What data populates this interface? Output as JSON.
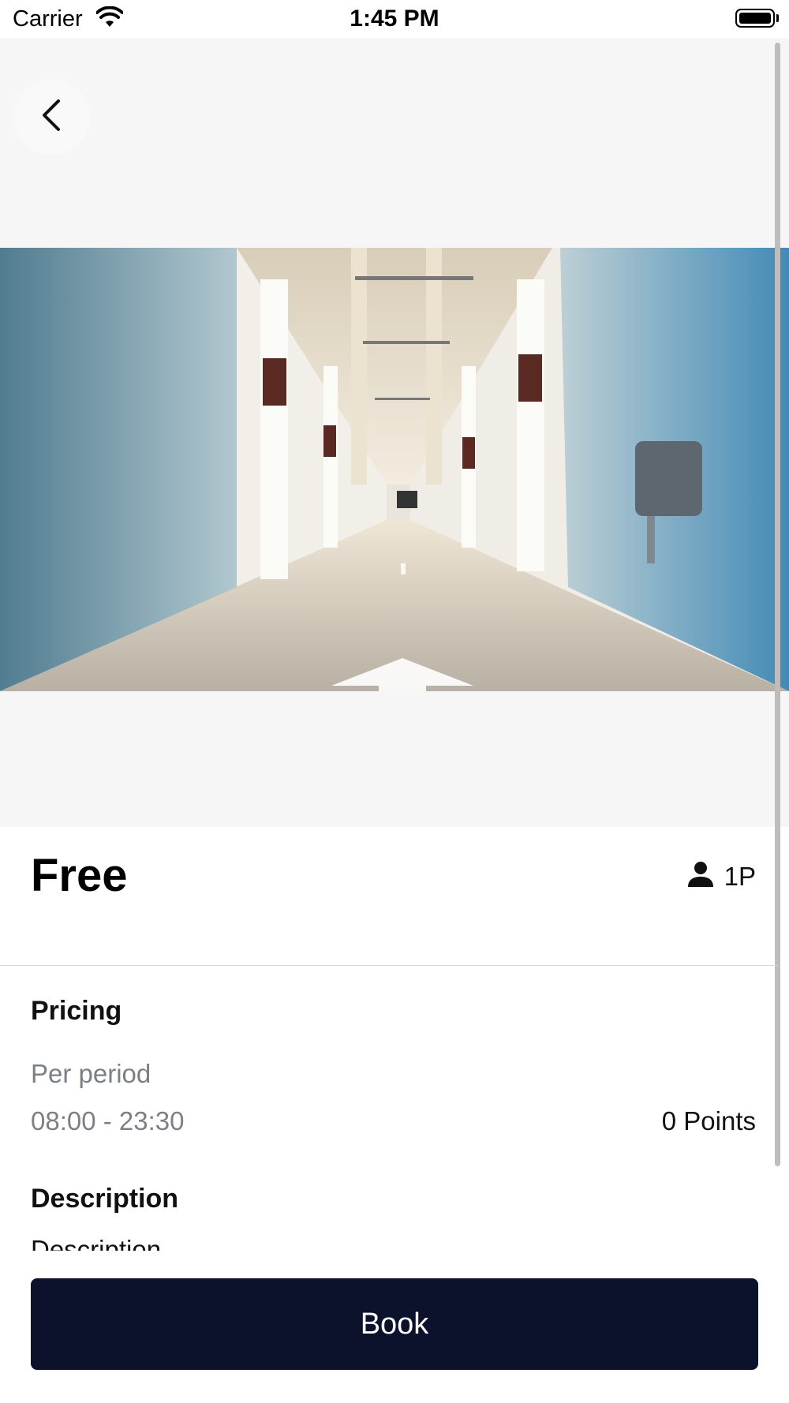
{
  "status_bar": {
    "carrier": "Carrier",
    "time": "1:45 PM"
  },
  "space": {
    "title": "Free",
    "capacity": "1P"
  },
  "pricing": {
    "heading": "Pricing",
    "period_label": "Per period",
    "time_range": "08:00 - 23:30",
    "points": "0 Points"
  },
  "description": {
    "heading": "Description",
    "body": "Description"
  },
  "actions": {
    "book_label": "Book"
  },
  "colors": {
    "book_button": "#0c122b",
    "muted_text": "#7b7f86",
    "hero_background": "#f6f6f6"
  },
  "icons": [
    "chevron-left-icon",
    "person-icon",
    "wifi-icon",
    "battery-icon"
  ]
}
